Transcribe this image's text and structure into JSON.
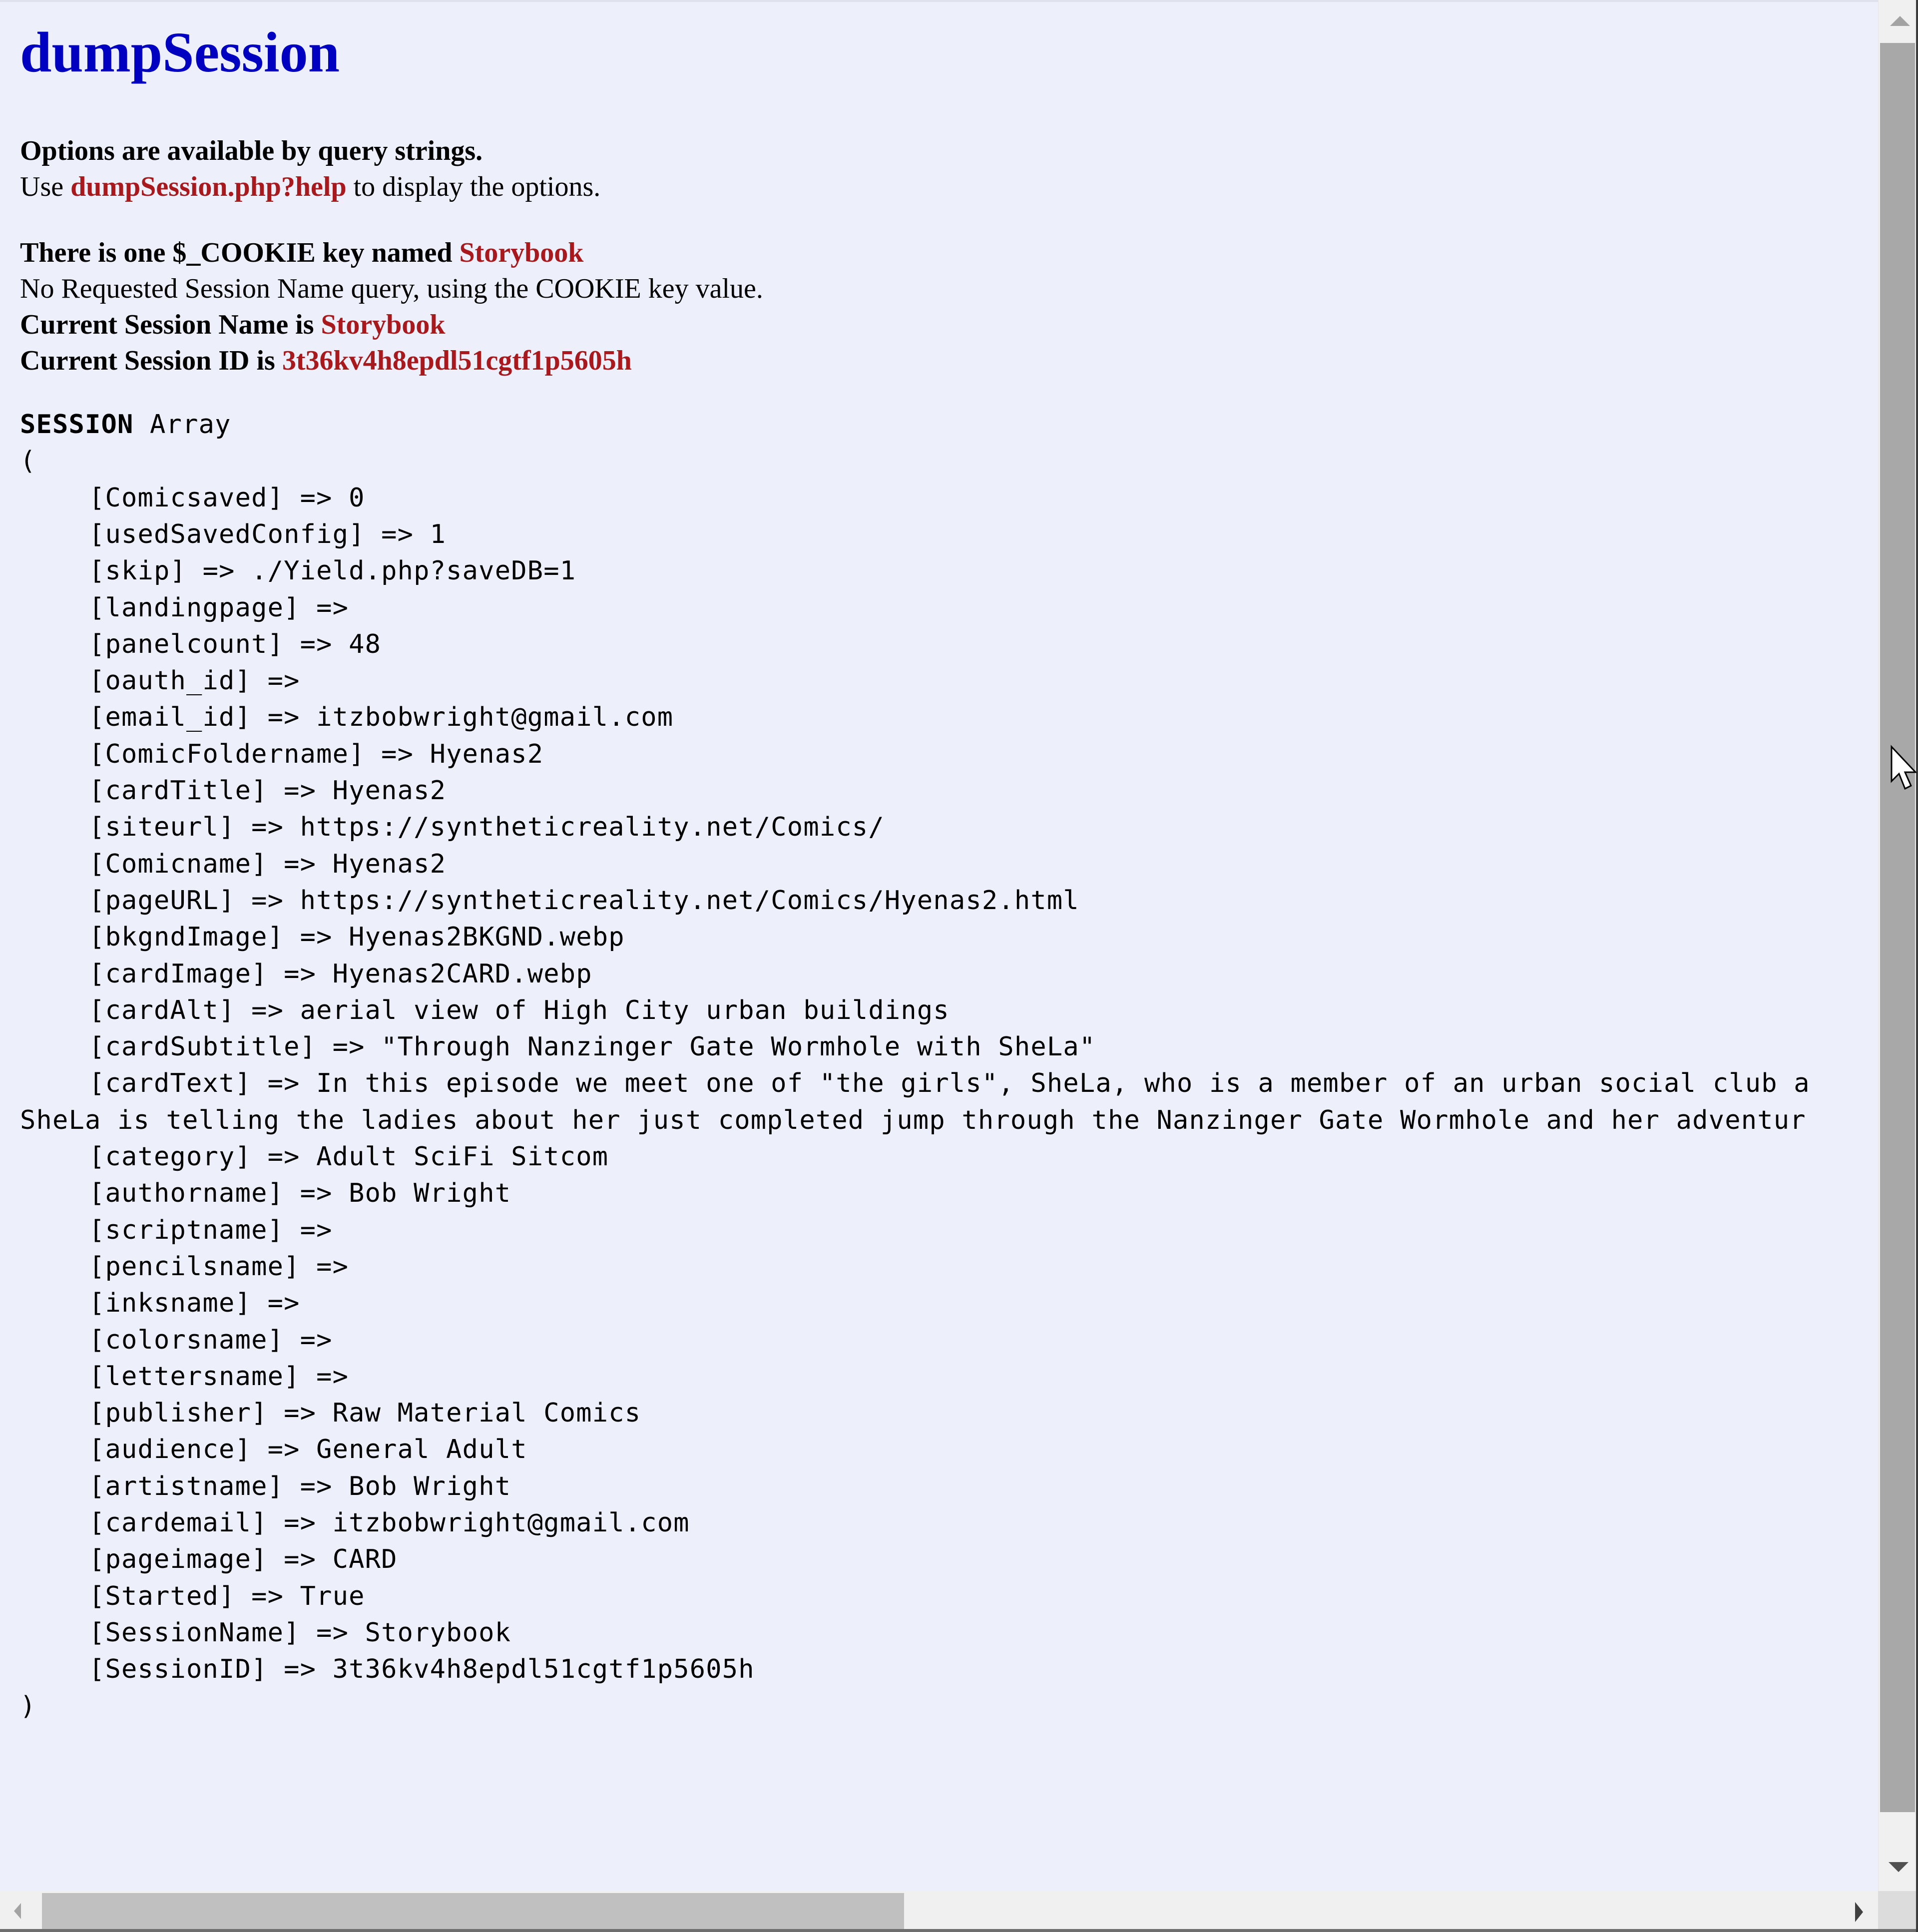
{
  "page": {
    "title": "dumpSession",
    "options_line": "Options are available by query strings.",
    "use_prefix": "Use ",
    "help_link": "dumpSession.php?help",
    "use_suffix": " to display the options.",
    "cookie_prefix": "There is one $_COOKIE key named ",
    "cookie_key": "Storybook",
    "no_query_line": "No Requested Session Name query, using the COOKIE key value.",
    "session_name_prefix": "Current Session Name is ",
    "session_name": "Storybook",
    "session_id_prefix": "Current Session ID is ",
    "session_id": "3t36kv4h8epdl51cgtf1p5605h"
  },
  "dump": {
    "header_bold": "SESSION",
    "header_rest": " Array",
    "open_paren": "(",
    "close_paren": ")",
    "arrow": " => ",
    "entries": [
      {
        "key": "Comicsaved",
        "value": "0"
      },
      {
        "key": "usedSavedConfig",
        "value": "1"
      },
      {
        "key": "skip",
        "value": "./Yield.php?saveDB=1"
      },
      {
        "key": "landingpage",
        "value": ""
      },
      {
        "key": "panelcount",
        "value": "48"
      },
      {
        "key": "oauth_id",
        "value": ""
      },
      {
        "key": "email_id",
        "value": "itzbobwright@gmail.com"
      },
      {
        "key": "ComicFoldername",
        "value": "Hyenas2"
      },
      {
        "key": "cardTitle",
        "value": "Hyenas2"
      },
      {
        "key": "siteurl",
        "value": "https://syntheticreality.net/Comics/"
      },
      {
        "key": "Comicname",
        "value": "Hyenas2"
      },
      {
        "key": "pageURL",
        "value": "https://syntheticreality.net/Comics/Hyenas2.html"
      },
      {
        "key": "bkgndImage",
        "value": "Hyenas2BKGND.webp"
      },
      {
        "key": "cardImage",
        "value": "Hyenas2CARD.webp"
      },
      {
        "key": "cardAlt",
        "value": "aerial view of High City urban buildings"
      },
      {
        "key": "cardSubtitle",
        "value": "\"Through Nanzinger Gate Wormhole with SheLa\""
      },
      {
        "key": "cardText",
        "value": "In this episode we meet one of \"the girls\", SheLa, who is a member of an urban social club a",
        "continuation": "SheLa is telling the ladies about her just completed jump through the Nanzinger Gate Wormhole and her adventur"
      },
      {
        "key": "category",
        "value": "Adult SciFi Sitcom"
      },
      {
        "key": "authorname",
        "value": "Bob Wright"
      },
      {
        "key": "scriptname",
        "value": ""
      },
      {
        "key": "pencilsname",
        "value": ""
      },
      {
        "key": "inksname",
        "value": ""
      },
      {
        "key": "colorsname",
        "value": ""
      },
      {
        "key": "lettersname",
        "value": ""
      },
      {
        "key": "publisher",
        "value": "Raw Material Comics"
      },
      {
        "key": "audience",
        "value": "General Adult"
      },
      {
        "key": "artistname",
        "value": "Bob Wright"
      },
      {
        "key": "cardemail",
        "value": "itzbobwright@gmail.com"
      },
      {
        "key": "pageimage",
        "value": "CARD"
      },
      {
        "key": "Started",
        "value": "True"
      },
      {
        "key": "SessionName",
        "value": "Storybook"
      },
      {
        "key": "SessionID",
        "value": "3t36kv4h8epdl51cgtf1p5605h"
      }
    ]
  },
  "scrollbars": {
    "vertical_icons": [
      "scroll-up-arrow-icon",
      "scroll-down-arrow-icon"
    ],
    "horizontal_icons": [
      "scroll-left-arrow-icon",
      "scroll-right-arrow-icon"
    ]
  },
  "colors": {
    "title": "#0000c0",
    "highlight": "#a8191e",
    "background": "#edf0fb"
  }
}
